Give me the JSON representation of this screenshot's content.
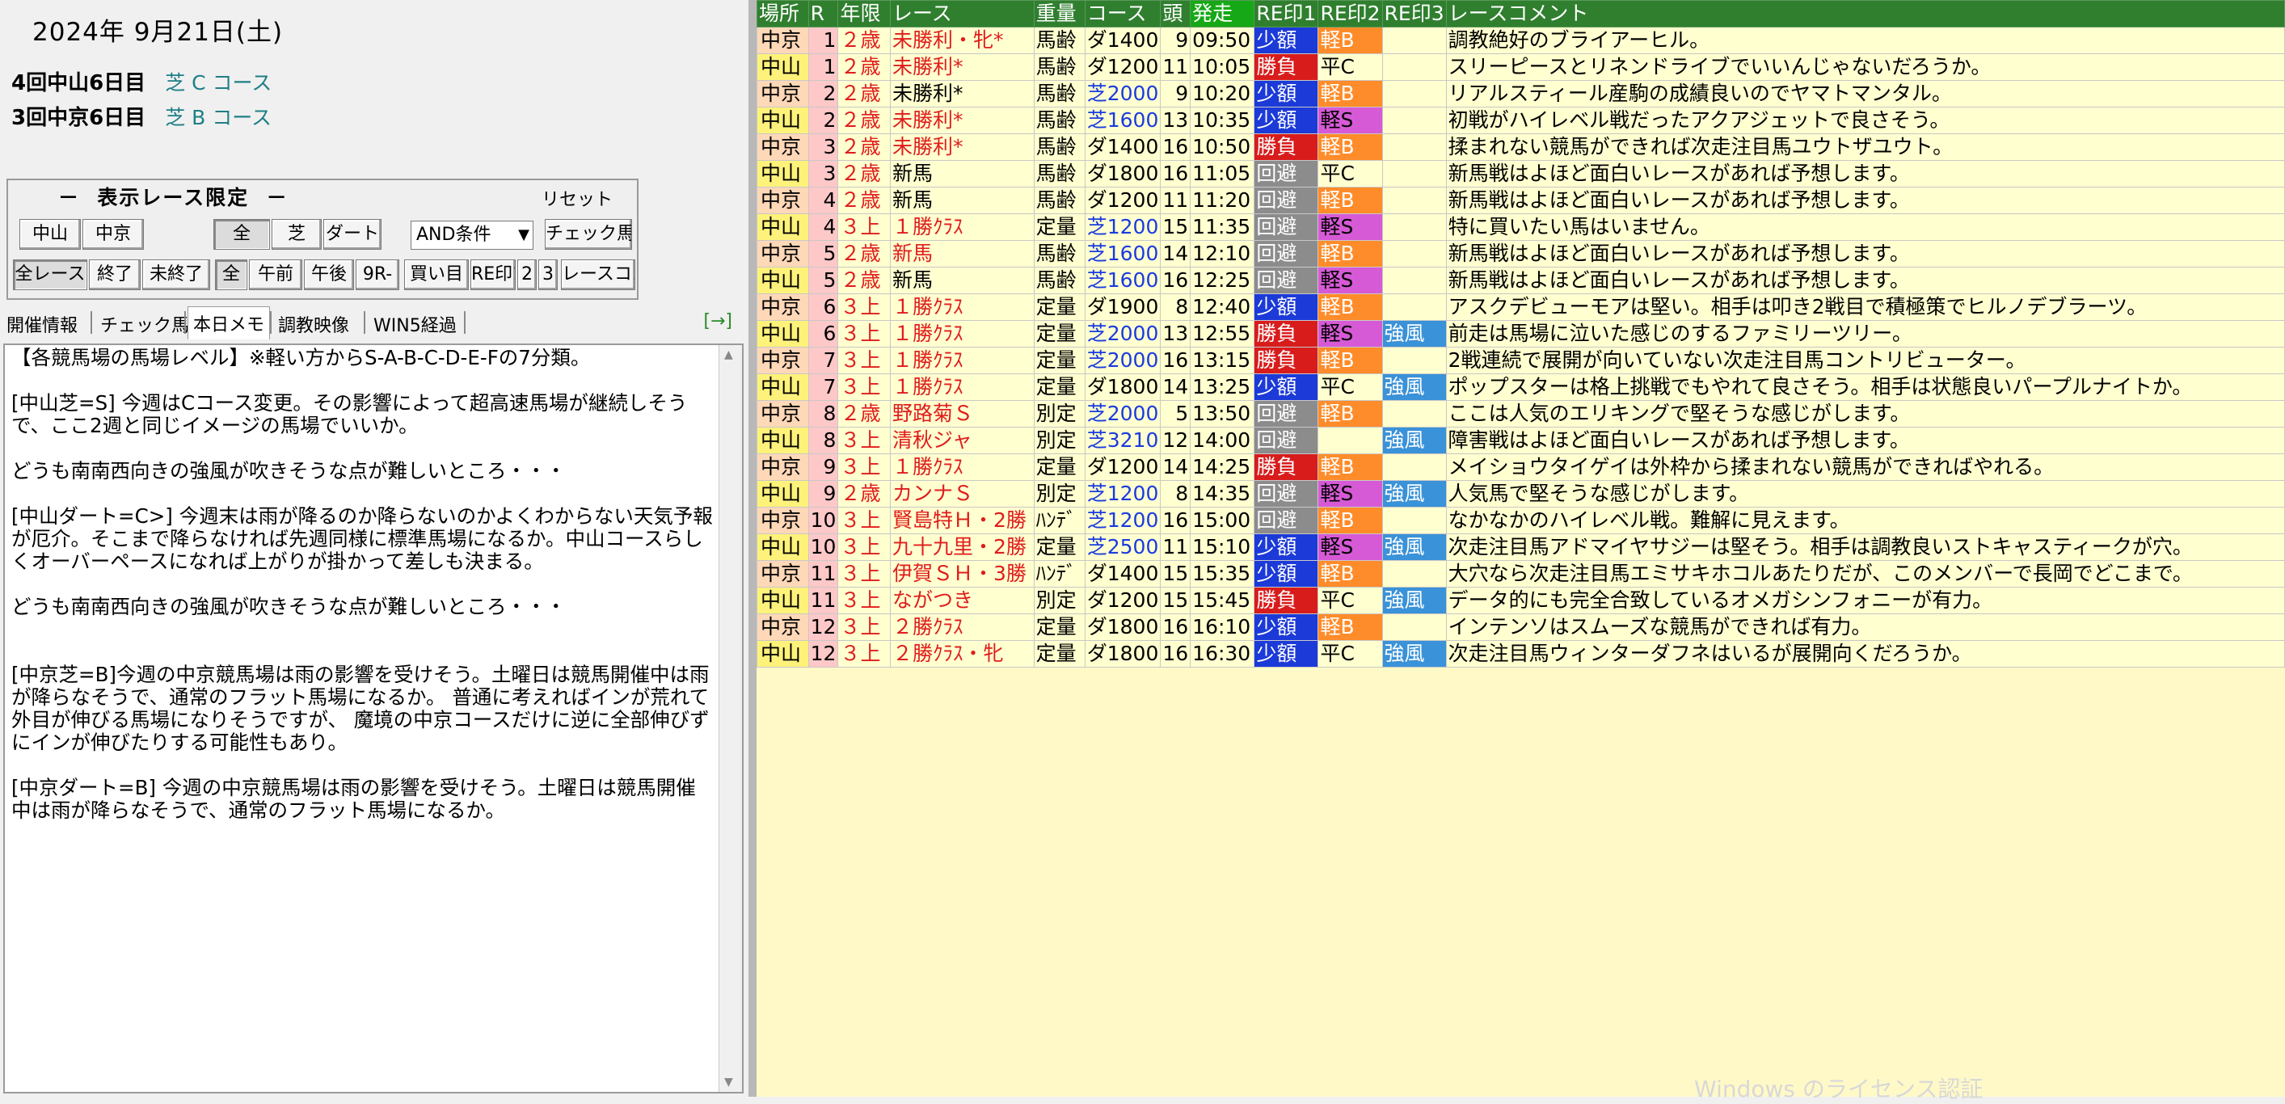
{
  "date": "2024年  9月21日(土)",
  "meetings": [
    {
      "name": "4回中山6日目",
      "course": "芝 C コース"
    },
    {
      "name": "3回中京6日目",
      "course": "芝 B コース"
    }
  ],
  "filter": {
    "title": "－  表示レース限定  －",
    "reset": "リセット",
    "row1": [
      "中山",
      "中京",
      "全",
      "芝",
      "ダート"
    ],
    "select_value": "AND条件",
    "check_button": "チェック馬",
    "row2": [
      "全レース",
      "終了",
      "未終了",
      "全",
      "午前",
      "午後",
      "9R-",
      "買い目",
      "RE印1",
      "2",
      "3",
      "レースコメ"
    ]
  },
  "tabs": [
    "開催情報",
    "チェック馬",
    "本日メモ",
    "調教映像",
    "WIN5経過"
  ],
  "tab_arrow": "[→]",
  "memo_text": "【各競馬場の馬場レベル】※軽い方からS-A-B-C-D-E-Fの7分類。\n\n[中山芝=S] 今週はCコース変更。その影響によって超高速馬場が継続しそうで、ここ2週と同じイメージの馬場でいいか。\n\nどうも南南西向きの強風が吹きそうな点が難しいところ・・・\n\n[中山ダート=C>] 今週末は雨が降るのか降らないのかよくわからない天気予報が厄介。そこまで降らなければ先週同様に標準馬場になるか。中山コースらしくオーバーペースになれば上がりが掛かって差しも決まる。\n\nどうも南南西向きの強風が吹きそうな点が難しいところ・・・\n\n\n[中京芝=B]今週の中京競馬場は雨の影響を受けそう。土曜日は競馬開催中は雨が降らなそうで、通常のフラット馬場になるか。 普通に考えればインが荒れて外目が伸びる馬場になりそうですが、 魔境の中京コースだけに逆に全部伸びずにインが伸びたりする可能性もあり。\n\n[中京ダート=B] 今週の中京競馬場は雨の影響を受けそう。土曜日は競馬開催中は雨が降らなそうで、通常のフラット馬場になるか。",
  "table": {
    "headers": [
      "場所",
      "R",
      "年限",
      "レース",
      "重量",
      "コース",
      "頭",
      "発走",
      "RE印1",
      "RE印2",
      "RE印3",
      "レースコメント"
    ],
    "rows": [
      {
        "place": "中京",
        "r": "1",
        "age": "２歳",
        "race": "未勝利・牝*",
        "race_red": true,
        "weight": "馬齢",
        "course": "ダ1400",
        "turf": false,
        "heads": "9",
        "time": "09:50",
        "re1": "少額",
        "re2": "軽B",
        "re3": "",
        "comment": "調教絶好のブライアーヒル。"
      },
      {
        "place": "中山",
        "r": "1",
        "age": "２歳",
        "race": "未勝利*",
        "race_red": true,
        "weight": "馬齢",
        "course": "ダ1200",
        "turf": false,
        "heads": "11",
        "time": "10:05",
        "re1": "勝負",
        "re2": "平C",
        "re3": "",
        "comment": "スリーピースとリネンドライブでいいんじゃないだろうか。"
      },
      {
        "place": "中京",
        "r": "2",
        "age": "２歳",
        "race": "未勝利*",
        "race_red": false,
        "weight": "馬齢",
        "course": "芝2000",
        "turf": true,
        "heads": "9",
        "time": "10:20",
        "re1": "少額",
        "re2": "軽B",
        "re3": "",
        "comment": "リアルスティール産駒の成績良いのでヤマトマンタル。"
      },
      {
        "place": "中山",
        "r": "2",
        "age": "２歳",
        "race": "未勝利*",
        "race_red": true,
        "weight": "馬齢",
        "course": "芝1600",
        "turf": true,
        "heads": "13",
        "time": "10:35",
        "re1": "少額",
        "re2": "軽S",
        "re3": "",
        "comment": "初戦がハイレベル戦だったアクアジェットで良さそう。"
      },
      {
        "place": "中京",
        "r": "3",
        "age": "２歳",
        "race": "未勝利*",
        "race_red": true,
        "weight": "馬齢",
        "course": "ダ1400",
        "turf": false,
        "heads": "16",
        "time": "10:50",
        "re1": "勝負",
        "re2": "軽B",
        "re3": "",
        "comment": "揉まれない競馬ができれば次走注目馬ユウトザユウト。"
      },
      {
        "place": "中山",
        "r": "3",
        "age": "２歳",
        "race": "新馬",
        "race_red": false,
        "weight": "馬齢",
        "course": "ダ1800",
        "turf": false,
        "heads": "16",
        "time": "11:05",
        "re1": "回避",
        "re2": "平C",
        "re3": "",
        "comment": "新馬戦はよほど面白いレースがあれば予想します。"
      },
      {
        "place": "中京",
        "r": "4",
        "age": "２歳",
        "race": "新馬",
        "race_red": false,
        "weight": "馬齢",
        "course": "ダ1200",
        "turf": false,
        "heads": "11",
        "time": "11:20",
        "re1": "回避",
        "re2": "軽B",
        "re3": "",
        "comment": "新馬戦はよほど面白いレースがあれば予想します。"
      },
      {
        "place": "中山",
        "r": "4",
        "age": "３上",
        "race": "１勝ｸﾗｽ",
        "race_red": true,
        "weight": "定量",
        "course": "芝1200",
        "turf": true,
        "heads": "15",
        "time": "11:35",
        "re1": "回避",
        "re2": "軽S",
        "re3": "",
        "comment": "特に買いたい馬はいません。"
      },
      {
        "place": "中京",
        "r": "5",
        "age": "２歳",
        "race": "新馬",
        "race_red": true,
        "weight": "馬齢",
        "course": "芝1600",
        "turf": true,
        "heads": "14",
        "time": "12:10",
        "re1": "回避",
        "re2": "軽B",
        "re3": "",
        "comment": "新馬戦はよほど面白いレースがあれば予想します。"
      },
      {
        "place": "中山",
        "r": "5",
        "age": "２歳",
        "race": "新馬",
        "race_red": false,
        "weight": "馬齢",
        "course": "芝1600",
        "turf": true,
        "heads": "16",
        "time": "12:25",
        "re1": "回避",
        "re2": "軽S",
        "re3": "",
        "comment": "新馬戦はよほど面白いレースがあれば予想します。"
      },
      {
        "place": "中京",
        "r": "6",
        "age": "３上",
        "race": "１勝ｸﾗｽ",
        "race_red": true,
        "weight": "定量",
        "course": "ダ1900",
        "turf": false,
        "heads": "8",
        "time": "12:40",
        "re1": "少額",
        "re2": "軽B",
        "re3": "",
        "comment": "アスクデビューモアは堅い。相手は叩き2戦目で積極策でヒルノデブラーツ。"
      },
      {
        "place": "中山",
        "r": "6",
        "age": "３上",
        "race": "１勝ｸﾗｽ",
        "race_red": true,
        "weight": "定量",
        "course": "芝2000",
        "turf": true,
        "heads": "13",
        "time": "12:55",
        "re1": "勝負",
        "re2": "軽S",
        "re3": "強風",
        "comment": "前走は馬場に泣いた感じのするファミリーツリー。"
      },
      {
        "place": "中京",
        "r": "7",
        "age": "３上",
        "race": "１勝ｸﾗｽ",
        "race_red": true,
        "weight": "定量",
        "course": "芝2000",
        "turf": true,
        "heads": "16",
        "time": "13:15",
        "re1": "勝負",
        "re2": "軽B",
        "re3": "",
        "comment": "2戦連続で展開が向いていない次走注目馬コントリビューター。"
      },
      {
        "place": "中山",
        "r": "7",
        "age": "３上",
        "race": "１勝ｸﾗｽ",
        "race_red": true,
        "weight": "定量",
        "course": "ダ1800",
        "turf": false,
        "heads": "14",
        "time": "13:25",
        "re1": "少額",
        "re2": "平C",
        "re3": "強風",
        "comment": "ポップスターは格上挑戦でもやれて良さそう。相手は状態良いパープルナイトか。"
      },
      {
        "place": "中京",
        "r": "8",
        "age": "２歳",
        "race": "野路菊Ｓ",
        "race_red": true,
        "weight": "別定",
        "course": "芝2000",
        "turf": true,
        "heads": "5",
        "time": "13:50",
        "re1": "回避",
        "re2": "軽B",
        "re3": "",
        "comment": "ここは人気のエリキングで堅そうな感じがします。"
      },
      {
        "place": "中山",
        "r": "8",
        "age": "３上",
        "race": "清秋ジャ",
        "race_red": true,
        "weight": "別定",
        "course": "芝3210",
        "turf": true,
        "heads": "12",
        "time": "14:00",
        "re1": "回避",
        "re2": "",
        "re3": "強風",
        "comment": "障害戦はよほど面白いレースがあれば予想します。"
      },
      {
        "place": "中京",
        "r": "9",
        "age": "３上",
        "race": "１勝ｸﾗｽ",
        "race_red": true,
        "weight": "定量",
        "course": "ダ1200",
        "turf": false,
        "heads": "14",
        "time": "14:25",
        "re1": "勝負",
        "re2": "軽B",
        "re3": "",
        "comment": "メイショウタイゲイは外枠から揉まれない競馬ができればやれる。"
      },
      {
        "place": "中山",
        "r": "9",
        "age": "２歳",
        "race": "カンナＳ",
        "race_red": true,
        "weight": "別定",
        "course": "芝1200",
        "turf": true,
        "heads": "8",
        "time": "14:35",
        "re1": "回避",
        "re2": "軽S",
        "re3": "強風",
        "comment": "人気馬で堅そうな感じがします。"
      },
      {
        "place": "中京",
        "r": "10",
        "age": "３上",
        "race": "賢島特Ｈ・2勝",
        "race_red": true,
        "weight": "ﾊﾝﾃﾞ",
        "course": "芝1200",
        "turf": true,
        "heads": "16",
        "time": "15:00",
        "re1": "回避",
        "re2": "軽B",
        "re3": "",
        "comment": "なかなかのハイレベル戦。難解に見えます。"
      },
      {
        "place": "中山",
        "r": "10",
        "age": "３上",
        "race": "九十九里・2勝",
        "race_red": true,
        "weight": "定量",
        "course": "芝2500",
        "turf": true,
        "heads": "11",
        "time": "15:10",
        "re1": "少額",
        "re2": "軽S",
        "re3": "強風",
        "comment": "次走注目馬アドマイヤサジーは堅そう。相手は調教良いストキャスティークが穴。"
      },
      {
        "place": "中京",
        "r": "11",
        "age": "３上",
        "race": "伊賀ＳＨ・3勝",
        "race_red": true,
        "weight": "ﾊﾝﾃﾞ",
        "course": "ダ1400",
        "turf": false,
        "heads": "15",
        "time": "15:35",
        "re1": "少額",
        "re2": "軽B",
        "re3": "",
        "comment": "大穴なら次走注目馬エミサキホコルあたりだが、このメンバーで長岡でどこまで。"
      },
      {
        "place": "中山",
        "r": "11",
        "age": "３上",
        "race": "ながつき",
        "race_red": true,
        "weight": "別定",
        "course": "ダ1200",
        "turf": false,
        "heads": "15",
        "time": "15:45",
        "re1": "勝負",
        "re2": "平C",
        "re3": "強風",
        "comment": "データ的にも完全合致しているオメガシンフォニーが有力。"
      },
      {
        "place": "中京",
        "r": "12",
        "age": "３上",
        "race": "２勝ｸﾗｽ",
        "race_red": true,
        "weight": "定量",
        "course": "ダ1800",
        "turf": false,
        "heads": "16",
        "time": "16:10",
        "re1": "少額",
        "re2": "軽B",
        "re3": "",
        "comment": "インテンソはスムーズな競馬ができれば有力。"
      },
      {
        "place": "中山",
        "r": "12",
        "age": "３上",
        "race": "２勝ｸﾗｽ・牝",
        "race_red": true,
        "weight": "定量",
        "course": "ダ1800",
        "turf": false,
        "heads": "16",
        "time": "16:30",
        "re1": "少額",
        "re2": "平C",
        "re3": "強風",
        "comment": "次走注目馬ウィンターダフネはいるが展開向くだろうか。"
      }
    ]
  },
  "colors": {
    "header_green": "#2f7f2f",
    "re1_blue": "#1c3ad8",
    "re1_red": "#d81c1c",
    "re2_orange": "#ff8c2a",
    "re2_purple": "#d65ad6",
    "re3_wind": "#3a92d8"
  },
  "footer_partial": "Windows のライセンス認証"
}
